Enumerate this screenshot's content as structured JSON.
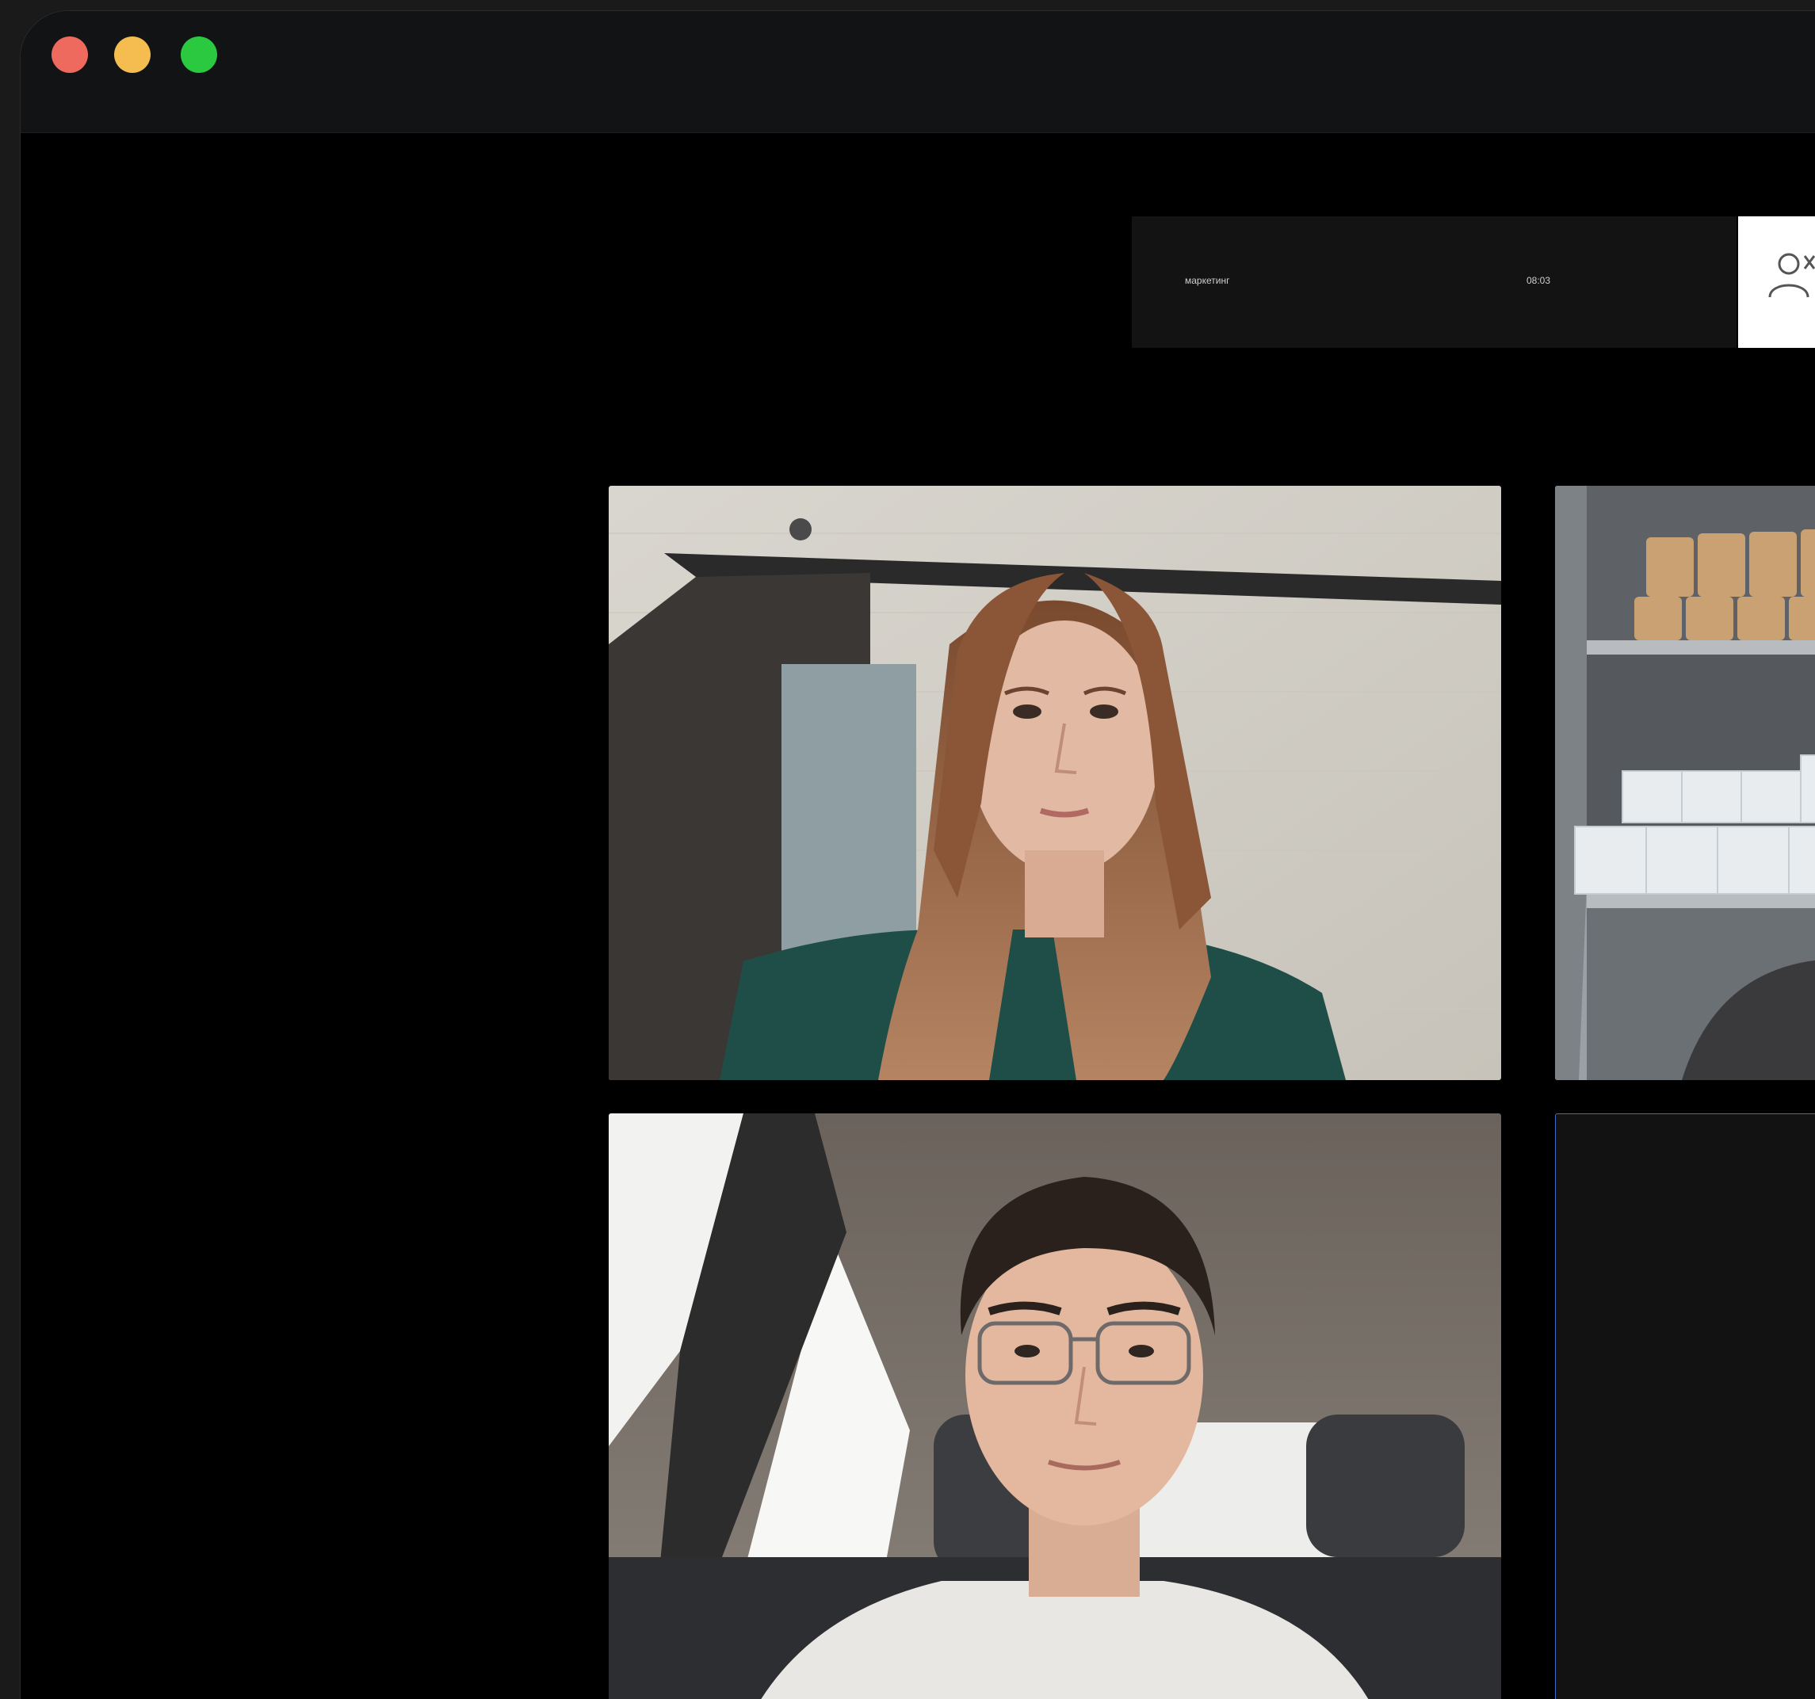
{
  "window": {
    "controls": {
      "close_color": "#ee6a5f",
      "minimize_color": "#f5bd4f",
      "maximize_color": "#2ac940"
    }
  },
  "meeting": {
    "name": "маркетинг",
    "duration": "08:03"
  },
  "toolbar": {
    "participants_icon": "participants-icon"
  },
  "tiles": [
    {
      "name": "participant-woman-green-sweater"
    },
    {
      "name": "participant-shelves-background"
    },
    {
      "name": "participant-man-in-car"
    },
    {
      "name": "participant-camera-off"
    }
  ],
  "colors": {
    "active_speaker_border": "#3b6bc4",
    "background": "#000000"
  }
}
